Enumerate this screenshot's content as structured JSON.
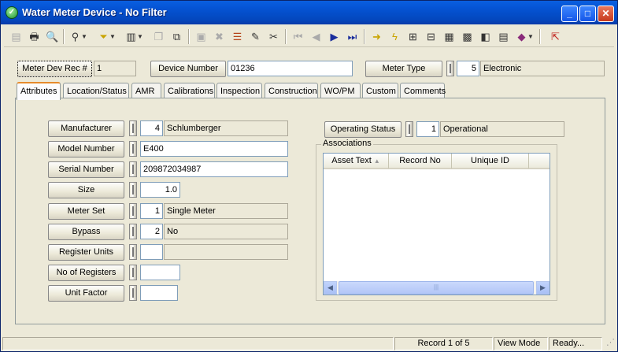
{
  "window": {
    "title": "Water Meter Device - No Filter"
  },
  "header": {
    "rec_label": "Meter Dev Rec #",
    "rec_value": "1",
    "device_number_label": "Device Number",
    "device_number_value": "01236",
    "meter_type_label": "Meter Type",
    "meter_type_code": "5",
    "meter_type_desc": "Electronic"
  },
  "tabs": [
    {
      "label": "Attributes"
    },
    {
      "label": "Location/Status"
    },
    {
      "label": "AMR"
    },
    {
      "label": "Calibrations"
    },
    {
      "label": "Inspection"
    },
    {
      "label": "Construction"
    },
    {
      "label": "WO/PM"
    },
    {
      "label": "Custom"
    },
    {
      "label": "Comments"
    }
  ],
  "attributes": {
    "manufacturer_label": "Manufacturer",
    "manufacturer_code": "4",
    "manufacturer_desc": "Schlumberger",
    "model_label": "Model Number",
    "model_value": "E400",
    "serial_label": "Serial Number",
    "serial_value": "209872034987",
    "size_label": "Size",
    "size_value": "1.0",
    "meter_set_label": "Meter Set",
    "meter_set_code": "1",
    "meter_set_desc": "Single Meter",
    "bypass_label": "Bypass",
    "bypass_code": "2",
    "bypass_desc": "No",
    "register_units_label": "Register Units",
    "register_units_code": "",
    "register_units_desc": "",
    "registers_label": "No of Registers",
    "registers_value": "",
    "unit_factor_label": "Unit Factor",
    "unit_factor_value": ""
  },
  "operating_status": {
    "label": "Operating Status",
    "code": "1",
    "desc": "Operational"
  },
  "associations": {
    "label": "Associations",
    "columns": [
      "Asset Text",
      "Record No",
      "Unique ID"
    ]
  },
  "status_bar": {
    "record": "Record 1 of 5",
    "mode": "View Mode",
    "state": "Ready..."
  }
}
